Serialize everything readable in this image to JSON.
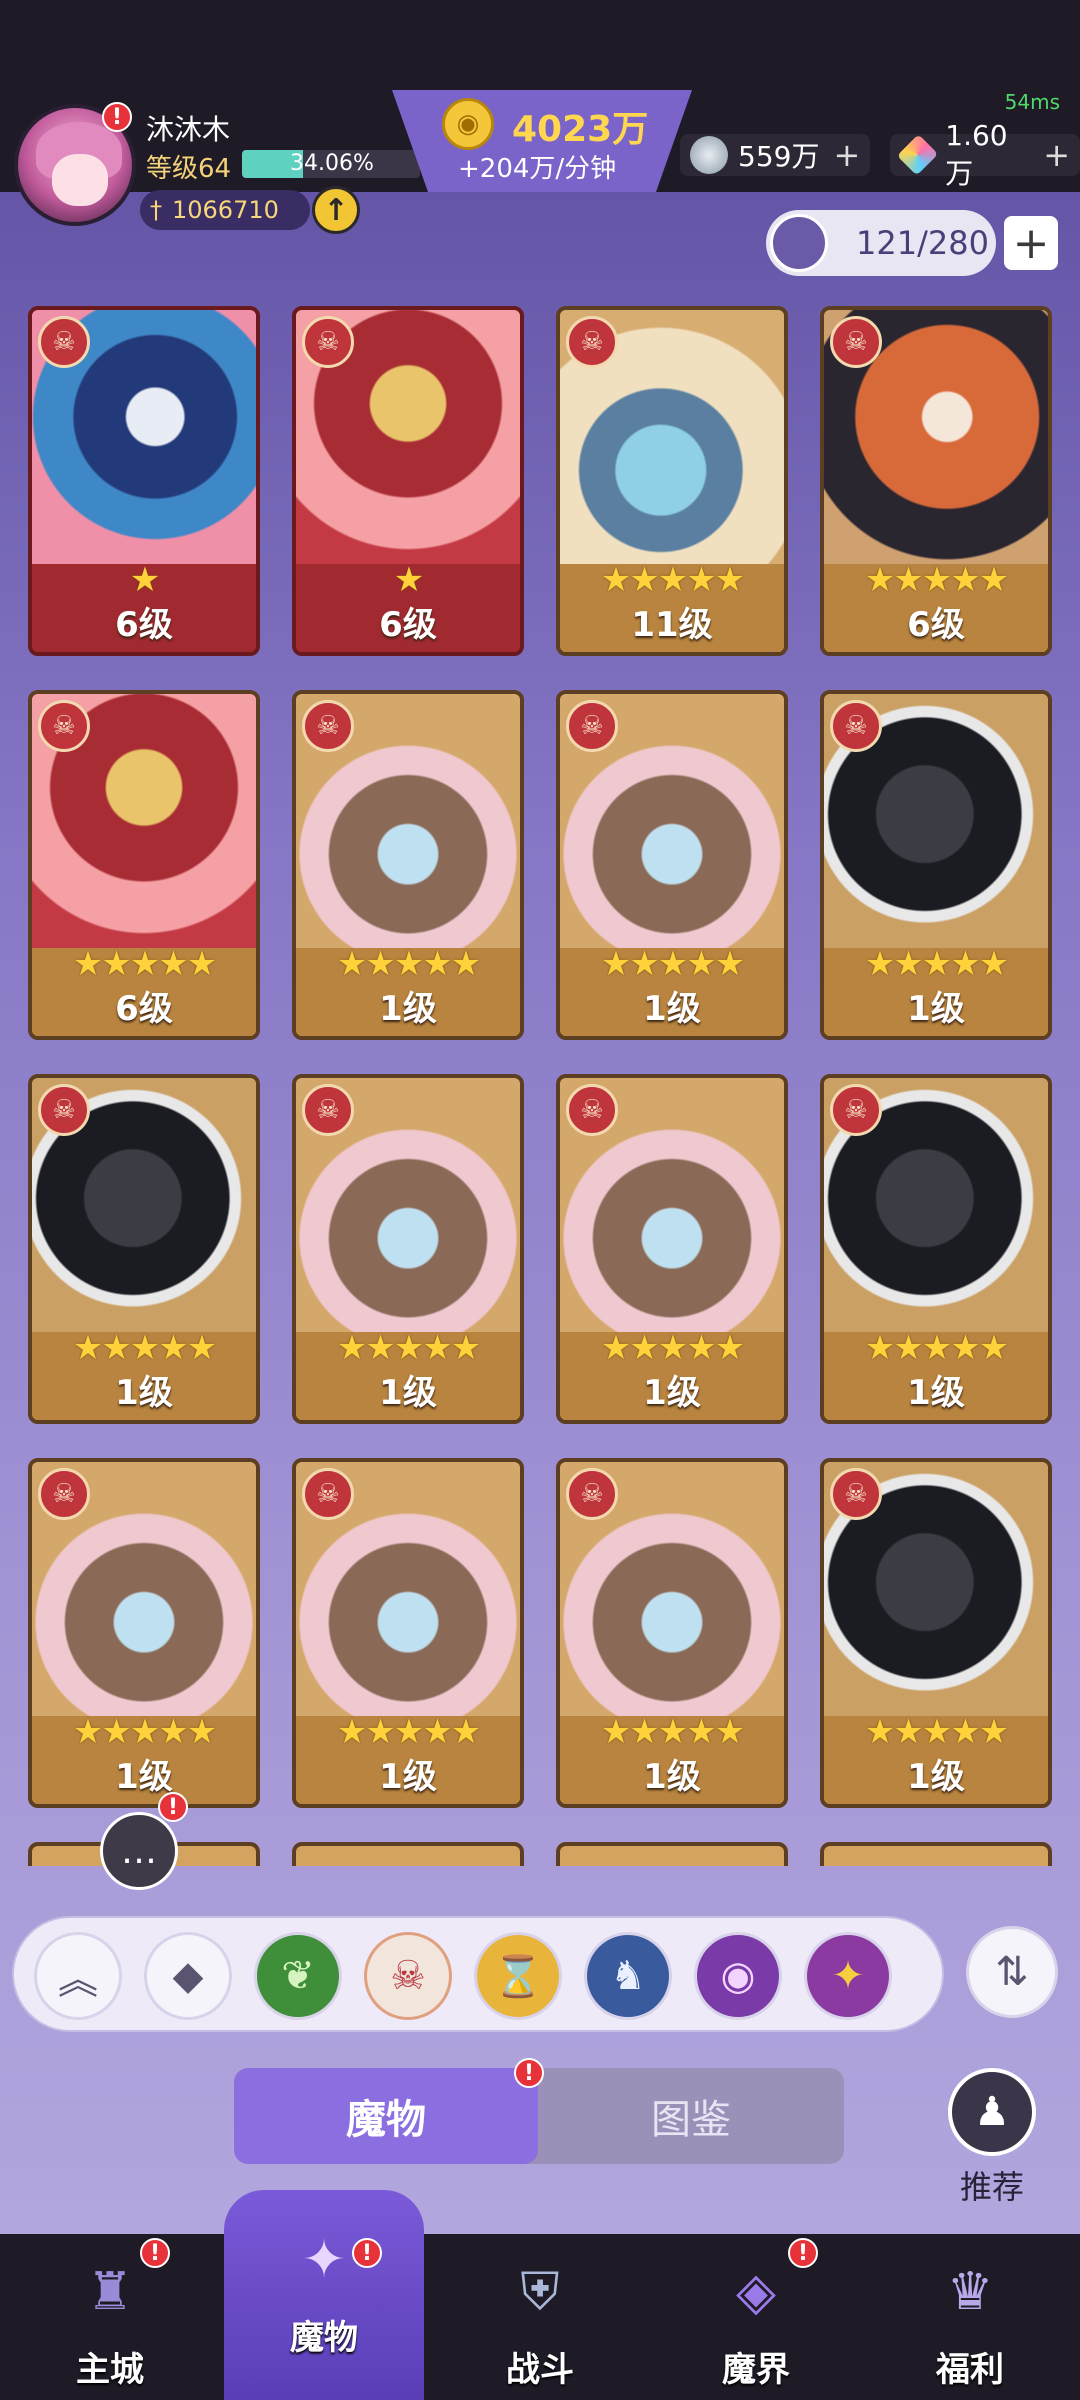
{
  "status": {
    "latency": "54ms"
  },
  "player": {
    "name": "沐沐木",
    "level": "等级64",
    "exp_percent": "34.06%",
    "exp_fraction": 0.3406,
    "power": "1066710"
  },
  "resources": {
    "gold": "4023万",
    "gold_rate": "+204万/分钟",
    "silver": "559万",
    "gem": "1.60万"
  },
  "capacity": {
    "text": "121/280"
  },
  "cards": [
    {
      "art": "dragon",
      "style": "red",
      "stars": "★",
      "level": "6级"
    },
    {
      "art": "mask",
      "style": "red",
      "stars": "★",
      "level": "6级"
    },
    {
      "art": "shark",
      "style": "gold",
      "stars": "★★★★★",
      "level": "11级"
    },
    {
      "art": "lion",
      "style": "gold",
      "stars": "★★★★★",
      "level": "6级"
    },
    {
      "art": "mask",
      "style": "gold",
      "stars": "★★★★★",
      "level": "6级"
    },
    {
      "art": "bunny",
      "style": "gold",
      "stars": "★★★★★",
      "level": "1级"
    },
    {
      "art": "bunny",
      "style": "gold",
      "stars": "★★★★★",
      "level": "1级"
    },
    {
      "art": "beast",
      "style": "gold",
      "stars": "★★★★★",
      "level": "1级"
    },
    {
      "art": "beast",
      "style": "gold",
      "stars": "★★★★★",
      "level": "1级"
    },
    {
      "art": "bunny",
      "style": "gold",
      "stars": "★★★★★",
      "level": "1级"
    },
    {
      "art": "bunny",
      "style": "gold",
      "stars": "★★★★★",
      "level": "1级"
    },
    {
      "art": "beast",
      "style": "gold",
      "stars": "★★★★★",
      "level": "1级"
    },
    {
      "art": "bunny",
      "style": "gold",
      "stars": "★★★★★",
      "level": "1级"
    },
    {
      "art": "bunny",
      "style": "gold",
      "stars": "★★★★★",
      "level": "1级"
    },
    {
      "art": "bunny",
      "style": "gold",
      "stars": "★★★★★",
      "level": "1级"
    },
    {
      "art": "beast",
      "style": "gold",
      "stars": "★★★★★",
      "level": "1级"
    }
  ],
  "filters": [
    "collapse",
    "all",
    "nature",
    "chaos",
    "order",
    "dragon",
    "eye",
    "star"
  ],
  "tabs": {
    "monsters": "魔物",
    "codex": "图鉴"
  },
  "recommend": {
    "label": "推荐"
  },
  "nav": {
    "city": "主城",
    "monster": "魔物",
    "battle": "战斗",
    "realm": "魔界",
    "welfare": "福利"
  }
}
